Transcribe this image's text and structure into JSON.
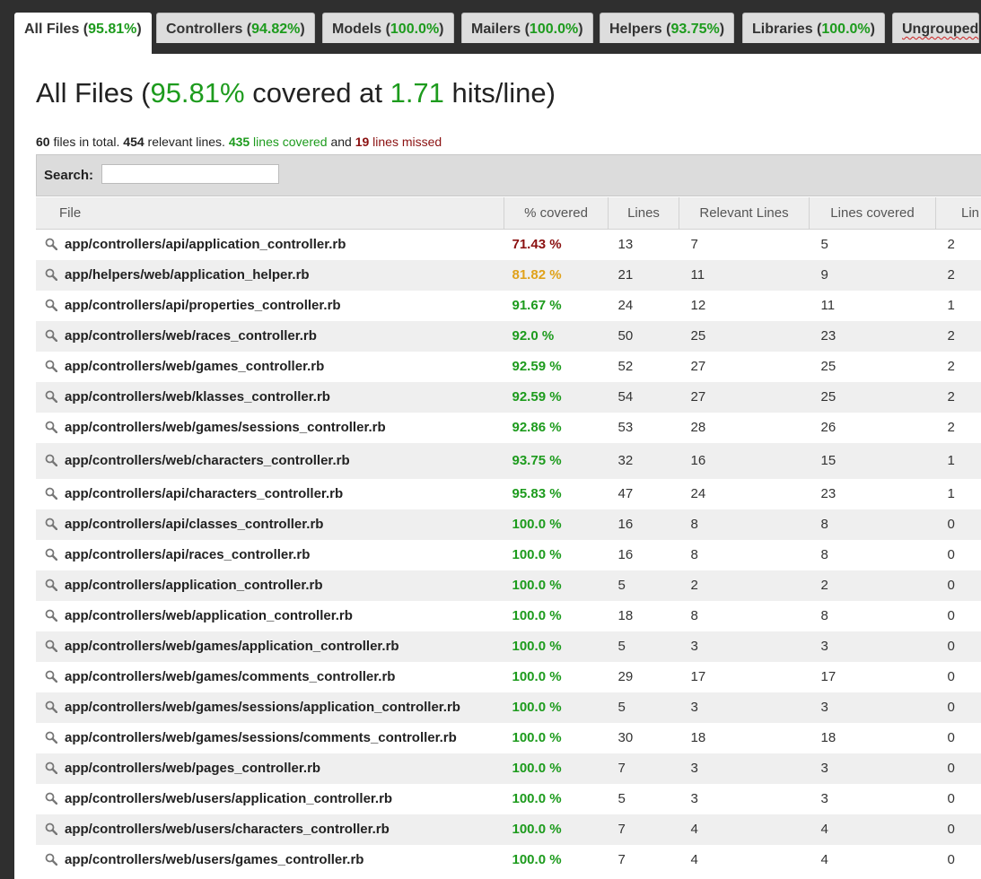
{
  "tabs": [
    {
      "name": "All Files",
      "pct": "95.81%",
      "active": true
    },
    {
      "name": "Controllers",
      "pct": "94.82%"
    },
    {
      "name": "Models",
      "pct": "100.0%"
    },
    {
      "name": "Mailers",
      "pct": "100.0%"
    },
    {
      "name": "Helpers",
      "pct": "93.75%"
    },
    {
      "name": "Libraries",
      "pct": "100.0%"
    },
    {
      "name": "Ungrouped",
      "pct": ""
    }
  ],
  "header": {
    "prefix": "All Files (",
    "coverage": "95.81%",
    "mid": " covered at ",
    "hits": "1.71",
    "suffix": " hits/line)"
  },
  "summary": {
    "files": "60",
    "files_label": " files in total. ",
    "relevant": "454",
    "relevant_label": " relevant lines. ",
    "covered": "435",
    "covered_label": " lines covered",
    "and": " and ",
    "missed": "19",
    "missed_label": " lines missed"
  },
  "search": {
    "label": "Search:",
    "placeholder": ""
  },
  "columns": [
    "File",
    "% covered",
    "Lines",
    "Relevant Lines",
    "Lines covered",
    "Lin"
  ],
  "rows": [
    {
      "file": "app/controllers/api/application_controller.rb",
      "cov": "71.43 %",
      "lines": "13",
      "rel": "7",
      "lcov": "5",
      "miss": "2",
      "status": "red"
    },
    {
      "file": "app/helpers/web/application_helper.rb",
      "cov": "81.82 %",
      "lines": "21",
      "rel": "11",
      "lcov": "9",
      "miss": "2",
      "status": "orange"
    },
    {
      "file": "app/controllers/api/properties_controller.rb",
      "cov": "91.67 %",
      "lines": "24",
      "rel": "12",
      "lcov": "11",
      "miss": "1",
      "status": "green"
    },
    {
      "file": "app/controllers/web/races_controller.rb",
      "cov": "92.0 %",
      "lines": "50",
      "rel": "25",
      "lcov": "23",
      "miss": "2",
      "status": "green"
    },
    {
      "file": "app/controllers/web/games_controller.rb",
      "cov": "92.59 %",
      "lines": "52",
      "rel": "27",
      "lcov": "25",
      "miss": "2",
      "status": "green"
    },
    {
      "file": "app/controllers/web/klasses_controller.rb",
      "cov": "92.59 %",
      "lines": "54",
      "rel": "27",
      "lcov": "25",
      "miss": "2",
      "status": "green"
    },
    {
      "file": "app/controllers/web/games/sessions_controller.rb",
      "cov": "92.86 %",
      "lines": "53",
      "rel": "28",
      "lcov": "26",
      "miss": "2",
      "status": "green"
    },
    {
      "file": "app/controllers/web/characters_controller.rb",
      "cov": "93.75 %",
      "lines": "32",
      "rel": "16",
      "lcov": "15",
      "miss": "1",
      "status": "green",
      "glitch": true
    },
    {
      "file": "app/controllers/api/characters_controller.rb",
      "cov": "95.83 %",
      "lines": "47",
      "rel": "24",
      "lcov": "23",
      "miss": "1",
      "status": "green"
    },
    {
      "file": "app/controllers/api/classes_controller.rb",
      "cov": "100.0 %",
      "lines": "16",
      "rel": "8",
      "lcov": "8",
      "miss": "0",
      "status": "green"
    },
    {
      "file": "app/controllers/api/races_controller.rb",
      "cov": "100.0 %",
      "lines": "16",
      "rel": "8",
      "lcov": "8",
      "miss": "0",
      "status": "green"
    },
    {
      "file": "app/controllers/application_controller.rb",
      "cov": "100.0 %",
      "lines": "5",
      "rel": "2",
      "lcov": "2",
      "miss": "0",
      "status": "green"
    },
    {
      "file": "app/controllers/web/application_controller.rb",
      "cov": "100.0 %",
      "lines": "18",
      "rel": "8",
      "lcov": "8",
      "miss": "0",
      "status": "green"
    },
    {
      "file": "app/controllers/web/games/application_controller.rb",
      "cov": "100.0 %",
      "lines": "5",
      "rel": "3",
      "lcov": "3",
      "miss": "0",
      "status": "green"
    },
    {
      "file": "app/controllers/web/games/comments_controller.rb",
      "cov": "100.0 %",
      "lines": "29",
      "rel": "17",
      "lcov": "17",
      "miss": "0",
      "status": "green"
    },
    {
      "file": "app/controllers/web/games/sessions/application_controller.rb",
      "cov": "100.0 %",
      "lines": "5",
      "rel": "3",
      "lcov": "3",
      "miss": "0",
      "status": "green"
    },
    {
      "file": "app/controllers/web/games/sessions/comments_controller.rb",
      "cov": "100.0 %",
      "lines": "30",
      "rel": "18",
      "lcov": "18",
      "miss": "0",
      "status": "green"
    },
    {
      "file": "app/controllers/web/pages_controller.rb",
      "cov": "100.0 %",
      "lines": "7",
      "rel": "3",
      "lcov": "3",
      "miss": "0",
      "status": "green"
    },
    {
      "file": "app/controllers/web/users/application_controller.rb",
      "cov": "100.0 %",
      "lines": "5",
      "rel": "3",
      "lcov": "3",
      "miss": "0",
      "status": "green"
    },
    {
      "file": "app/controllers/web/users/characters_controller.rb",
      "cov": "100.0 %",
      "lines": "7",
      "rel": "4",
      "lcov": "4",
      "miss": "0",
      "status": "green"
    },
    {
      "file": "app/controllers/web/users/games_controller.rb",
      "cov": "100.0 %",
      "lines": "7",
      "rel": "4",
      "lcov": "4",
      "miss": "0",
      "status": "green"
    }
  ],
  "colors": {
    "green": "#1d9b1d",
    "red": "#8b1111",
    "orange": "#e0a21b"
  }
}
